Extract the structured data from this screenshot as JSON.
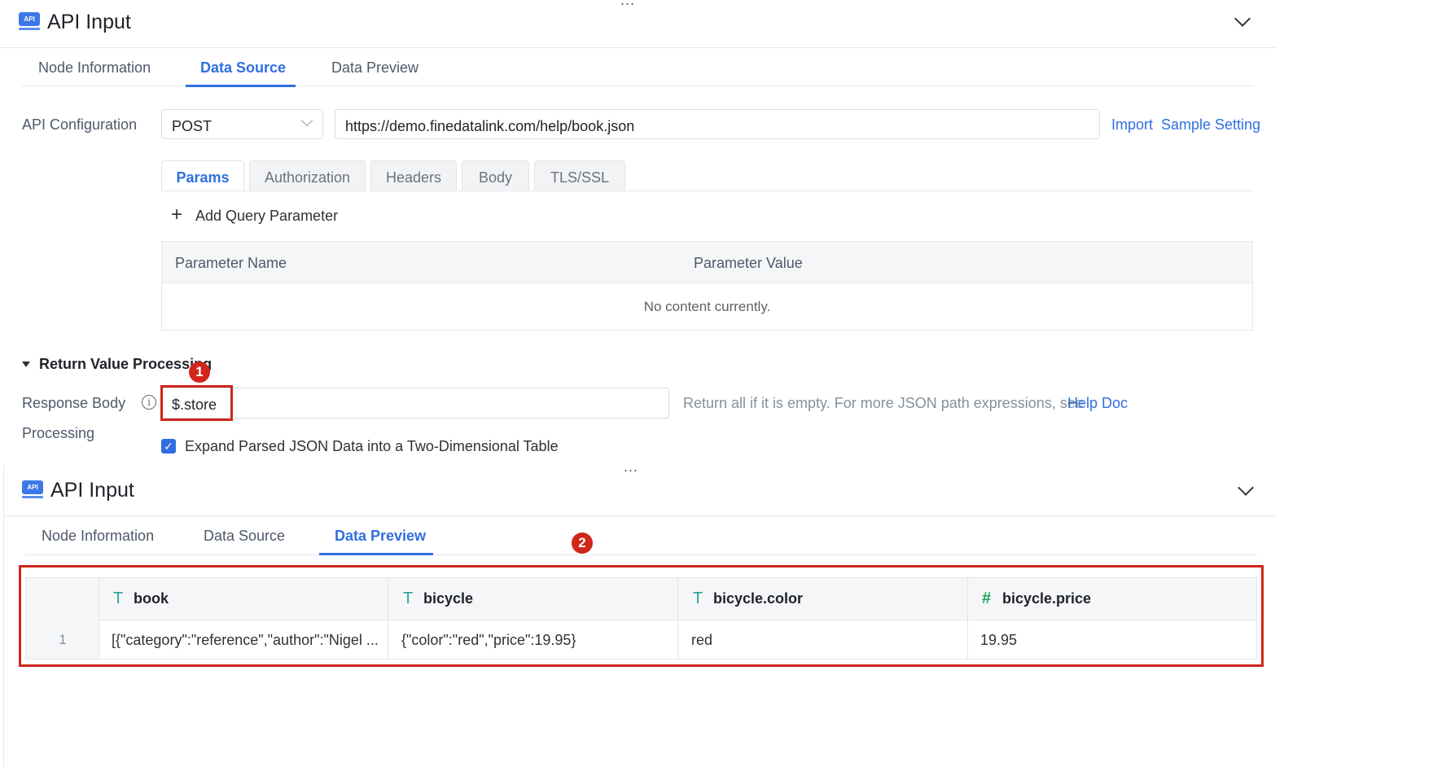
{
  "top_dots": "...",
  "panel1": {
    "title": "API Input",
    "tabs": [
      {
        "label": "Node Information",
        "active": false
      },
      {
        "label": "Data Source",
        "active": true
      },
      {
        "label": "Data Preview",
        "active": false
      }
    ],
    "api_config": {
      "label": "API Configuration",
      "method": "POST",
      "url": "https://demo.finedatalink.com/help/book.json",
      "import_label": "Import",
      "sample_setting_label": "Sample Setting"
    },
    "subtabs": [
      "Params",
      "Authorization",
      "Headers",
      "Body",
      "TLS/SSL"
    ],
    "active_subtab": "Params",
    "add_param_label": "Add Query Parameter",
    "params_table": {
      "headers": [
        "Parameter Name",
        "Parameter Value"
      ],
      "empty_text": "No content currently."
    },
    "return_value": {
      "section_label": "Return Value Processing",
      "response_body_label_line1": "Response Body",
      "response_body_label_line2": "Processing",
      "json_path": "$.store",
      "hint": "Return all if it is empty. For more JSON path expressions, see",
      "help_link": "Help Doc",
      "expand_checked": true,
      "expand_label": "Expand Parsed JSON Data into a Two-Dimensional Table"
    }
  },
  "middle_dots": "...",
  "panel2": {
    "title": "API Input",
    "tabs": [
      {
        "label": "Node Information",
        "active": false
      },
      {
        "label": "Data Source",
        "active": false
      },
      {
        "label": "Data Preview",
        "active": true
      }
    ],
    "preview_table": {
      "columns": [
        {
          "type_icon": "T",
          "type": "text",
          "name": "book"
        },
        {
          "type_icon": "T",
          "type": "text",
          "name": "bicycle"
        },
        {
          "type_icon": "T",
          "type": "text",
          "name": "bicycle.color"
        },
        {
          "type_icon": "#",
          "type": "number",
          "name": "bicycle.price"
        }
      ],
      "rows": [
        {
          "index": "1",
          "cells": [
            "[{\"category\":\"reference\",\"author\":\"Nigel ...",
            "{\"color\":\"red\",\"price\":19.95}",
            "red",
            "19.95"
          ]
        }
      ]
    }
  },
  "markers": [
    "1",
    "2"
  ],
  "colors": {
    "accent": "#2f6fe0",
    "annotation_red": "#d0261c",
    "text_type_icon": "#2aa198",
    "number_type_icon": "#20a35a"
  }
}
